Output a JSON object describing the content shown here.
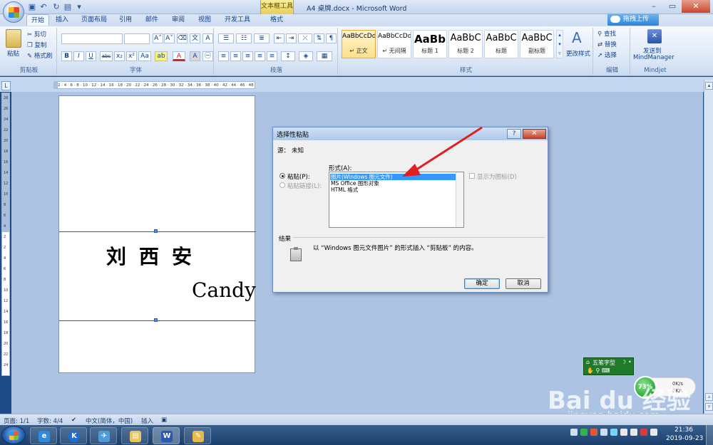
{
  "window": {
    "title": "A4 桌牌.docx - Microsoft Word",
    "context_tab": "文本框工具",
    "minimize": "–",
    "maximize": "▭",
    "close": "✕"
  },
  "quick_access": {
    "save": "▣",
    "undo": "↶",
    "redo": "↻",
    "print": "▤",
    "more": "▾"
  },
  "tabs": [
    "开始",
    "插入",
    "页面布局",
    "引用",
    "邮件",
    "审阅",
    "视图",
    "开发工具",
    "格式"
  ],
  "upload_button": "拖拽上传",
  "ribbon": {
    "clipboard": {
      "label": "剪贴板",
      "paste": "粘贴",
      "cut": "剪切",
      "copy": "复制",
      "format_painter": "格式刷"
    },
    "font": {
      "label": "字体",
      "grow": "A˄",
      "shrink": "A˅",
      "bold": "B",
      "italic": "I",
      "underline": "U",
      "strike": "abc",
      "subscript": "x₂",
      "superscript": "x²",
      "change_case": "Aa",
      "highlight": "ab",
      "font_color": "A"
    },
    "paragraph": {
      "label": "段落"
    },
    "styles": {
      "label": "样式",
      "items": [
        {
          "sample": "AaBbCcDd",
          "name": "↵ 正文"
        },
        {
          "sample": "AaBbCcDd",
          "name": "↵ 无间隔"
        },
        {
          "sample": "AaBb",
          "name": "标题 1"
        },
        {
          "sample": "AaBbC",
          "name": "标题 2"
        },
        {
          "sample": "AaBbC",
          "name": "标题"
        },
        {
          "sample": "AaBbC",
          "name": "副标题"
        }
      ],
      "change_styles": "更改样式"
    },
    "editing": {
      "label": "编辑",
      "find": "查找",
      "replace": "替换",
      "select": "选择"
    },
    "mindjet": {
      "label": "Mindjet",
      "send_line1": "发送到",
      "send_line2": "MindManager"
    }
  },
  "ruler": {
    "numbers": "2 · 4 · 6 · 8 · 10 · 12 · 14 · 16 · 18 · 20 · 22 · 24 · 26 · 28 · 30 · 32 · 34 · 36 · 38 · 40 · 42 · 44 · 46 · 48 · 50 · 52 · 54",
    "vertical_numbers": [
      "28",
      "26",
      "24",
      "22",
      "20",
      "18",
      "16",
      "14",
      "12",
      "10",
      "8",
      "6",
      "4",
      "2",
      "2",
      "4",
      "6",
      "8",
      "10",
      "12",
      "14",
      "16",
      "18",
      "20",
      "22",
      "24",
      "26"
    ]
  },
  "document": {
    "name": "刘西安",
    "english": "Candy"
  },
  "dialog": {
    "title": "选择性粘贴",
    "help": "?",
    "close": "✕",
    "source_label": "源：",
    "source_value": "未知",
    "format_label": "形式(A):",
    "paste_option": "粘贴(P):",
    "paste_link_option": "粘贴链接(L):",
    "list_items": [
      "图片(Windows 图元文件)",
      "MS Office 图形对象",
      "HTML 格式"
    ],
    "selected_index": 0,
    "display_as_icon": "显示为图标(D)",
    "result_label": "结果",
    "result_text": "以 “Windows 图元文件图片” 的形式插入 “剪贴板” 的内容。",
    "ok": "确定",
    "cancel": "取消"
  },
  "ime": {
    "name": "五笔字型",
    "moon": "☽",
    "mode": "•"
  },
  "network": {
    "percent": "73%",
    "up": "0K/s",
    "down": "0K/s"
  },
  "watermark": {
    "brand": "Bai du 经验",
    "url": "jingyan.baidu.com"
  },
  "status": {
    "page": "页面: 1/1",
    "words": "字数: 4/4",
    "language": "中文(简体，中国)",
    "insert": "插入"
  },
  "taskbar": {
    "time": "21:36",
    "date": "2019-09-23"
  },
  "colors": {
    "accent": "#15428b",
    "arrow": "#e02020",
    "selection": "#3399ff"
  }
}
